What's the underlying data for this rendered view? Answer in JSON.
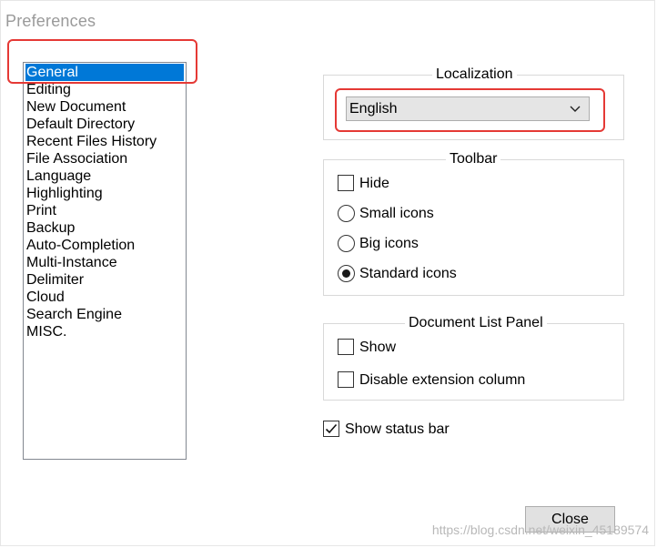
{
  "window": {
    "title": "Preferences"
  },
  "categories": [
    {
      "label": "General",
      "selected": true
    },
    {
      "label": "Editing"
    },
    {
      "label": "New Document"
    },
    {
      "label": "Default Directory"
    },
    {
      "label": "Recent Files History"
    },
    {
      "label": "File Association"
    },
    {
      "label": "Language"
    },
    {
      "label": "Highlighting"
    },
    {
      "label": "Print"
    },
    {
      "label": "Backup"
    },
    {
      "label": "Auto-Completion"
    },
    {
      "label": "Multi-Instance"
    },
    {
      "label": "Delimiter"
    },
    {
      "label": "Cloud"
    },
    {
      "label": "Search Engine"
    },
    {
      "label": "MISC."
    }
  ],
  "localization": {
    "title": "Localization",
    "language_value": "English"
  },
  "toolbar": {
    "title": "Toolbar",
    "hide_label": "Hide",
    "hide_checked": false,
    "small_icons_label": "Small icons",
    "big_icons_label": "Big icons",
    "standard_icons_label": "Standard icons",
    "selected_option": "Standard icons"
  },
  "document_list_panel": {
    "title": "Document List Panel",
    "show_label": "Show",
    "show_checked": false,
    "disable_ext_label": "Disable extension column",
    "disable_ext_checked": false
  },
  "status_bar": {
    "label": "Show status bar",
    "checked": true
  },
  "buttons": {
    "close_label": "Close"
  },
  "watermark": "https://blog.csdn.net/weixin_45189574",
  "colors": {
    "selection": "#0078d7",
    "annotation_red": "#e53935",
    "title_gray": "#9a9a9a"
  }
}
